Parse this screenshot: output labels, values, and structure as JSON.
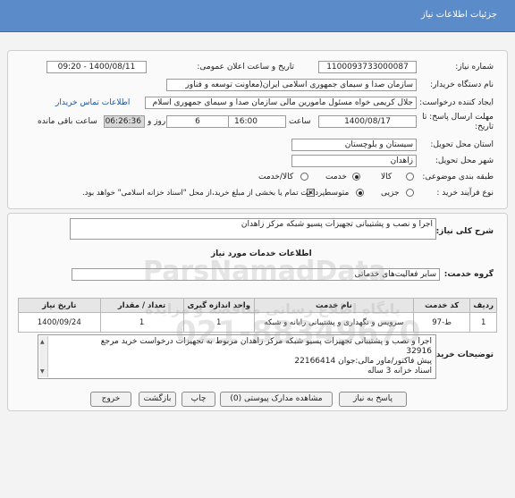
{
  "header": {
    "title": "جزئیات اطلاعات نیاز"
  },
  "info": {
    "need_number_label": "شماره نیاز:",
    "need_number": "1100093733000087",
    "announce_label": "تاریخ و ساعت اعلان عمومی:",
    "announce_value": "1400/08/11 - 09:20",
    "buyer_label": "نام دستگاه خریدار:",
    "buyer_value": "سازمان صدا و سیمای جمهوری اسلامی ایران(معاونت توسعه و فناور",
    "creator_label": "ایجاد کننده درخواست:",
    "creator_value": "جلال کریمی خواه مسئول مامورین مالی  سازمان صدا و سیمای جمهوری اسلام",
    "contact_link": "اطلاعات تماس خریدار",
    "deadline_label": "مهلت ارسال پاسخ: تا",
    "deadline_sub": "تاریخ:",
    "deadline_date": "1400/08/17",
    "time_label": "ساعت",
    "deadline_time": "16:00",
    "days": "6",
    "days_label": "روز و",
    "remaining": "06:26:36",
    "remaining_label": "ساعت باقی مانده",
    "province_label": "استان محل تحویل:",
    "province_value": "سیستان و بلوچستان",
    "city_label": "شهر محل تحویل:",
    "city_value": "زاهدان",
    "category_label": "طبقه بندی موضوعی:",
    "category_options": [
      "کالا",
      "خدمت",
      "کالا/خدمت"
    ],
    "process_label": "نوع فرآیند خرید :",
    "process_options": [
      "جزیی",
      "متوسط"
    ],
    "payment_note": "پرداخت تمام یا بخشی از مبلغ خرید،از محل \"اسناد خزانه اسلامی\" خواهد بود."
  },
  "summary": {
    "label": "شرح کلی نیاز:",
    "value": "اجرا و نصب و پشتیبانی تجهیزات پسیو شبکه مرکز زاهدان"
  },
  "services": {
    "section_title": "اطلاعات خدمات مورد نیاز",
    "group_label": "گروه خدمت:",
    "group_value": "سایر فعالیت‌های خدماتی",
    "columns": [
      "ردیف",
      "کد خدمت",
      "نام خدمت",
      "واحد اندازه گیری",
      "تعداد / مقدار",
      "تاریخ نیاز"
    ],
    "rows": [
      [
        "1",
        "ط-97",
        "سرویس و نگهداری و پشتیبانی رایانه و شبکه",
        "1",
        "1",
        "1400/09/24"
      ]
    ]
  },
  "buyer_notes": {
    "label": "توضیحات خریدار:",
    "lines": [
      "اجرا و نصب و پشتیبانی تجهیزات پسیو شبکه مرکز زاهدان مربوط به تجهیزات درخواست خرید مرجع",
      "32916",
      "پیش فاکتور/ماور مالی:جوان 22166414",
      "اسناد خزانه 3 ساله"
    ]
  },
  "buttons": {
    "respond": "پاسخ به نیاز",
    "attachments": "مشاهده مدارک پیوستی (0)",
    "print": "چاپ",
    "back": "بازگشت",
    "exit": "خروج"
  },
  "watermark": {
    "brand": "ParsNamadData",
    "sub": "پایگاه اطلاع رسانی مناقصه و مزایده",
    "phone": "021-88349670"
  },
  "colors": {
    "header": "#5b8cc9",
    "link": "#1a53a8",
    "panel": "#fafafa"
  }
}
